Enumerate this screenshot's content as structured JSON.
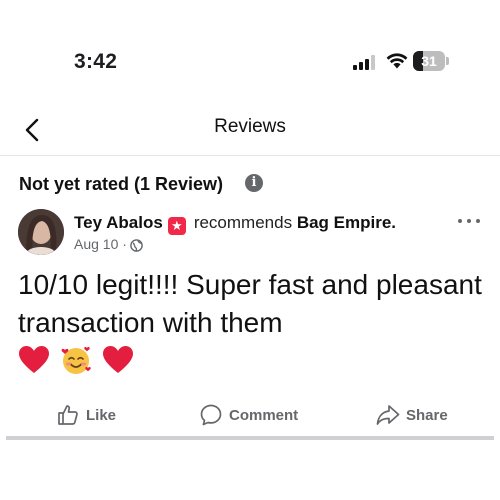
{
  "status_bar": {
    "time": "3:42",
    "battery_level": "31"
  },
  "header": {
    "title": "Reviews"
  },
  "summary": {
    "rating_text": "Not yet rated (1 Review)"
  },
  "review": {
    "reviewer_name": "Tey Abalos",
    "recommends_text": "recommends",
    "page_name": "Bag Empire.",
    "date": "Aug 10",
    "separator": "·",
    "text": "10/10 legit!!!! Super fast and pleasant transaction with them",
    "emojis": [
      "red-heart",
      "smiling-face-with-hearts",
      "red-heart"
    ]
  },
  "actions": {
    "like_label": "Like",
    "comment_label": "Comment",
    "share_label": "Share"
  },
  "colors": {
    "secondary_text": "#65676b",
    "badge": "#f02849",
    "heart": "#e41e3f"
  }
}
